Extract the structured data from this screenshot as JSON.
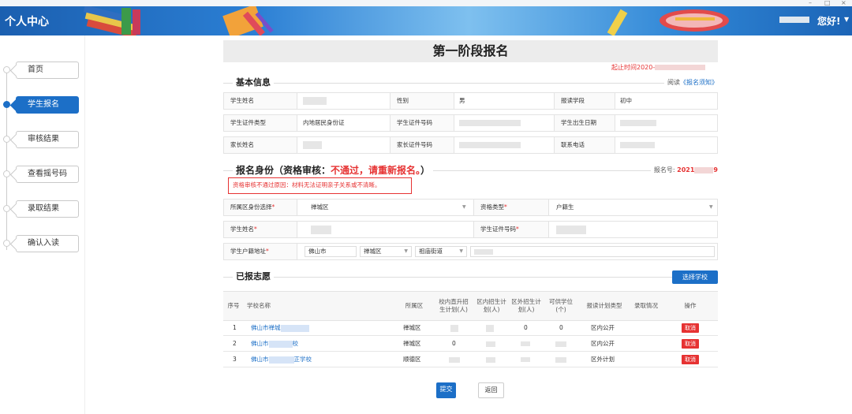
{
  "window": {
    "minimize": "–",
    "maximize": "□",
    "close": "×"
  },
  "header": {
    "title": "个人中心",
    "greeting": "您好!",
    "caret": "▼"
  },
  "sidebar": {
    "items": [
      {
        "label": "首页",
        "active": false
      },
      {
        "label": "学生报名",
        "active": true
      },
      {
        "label": "审核结果",
        "active": false
      },
      {
        "label": "查看摇号码",
        "active": false
      },
      {
        "label": "录取结果",
        "active": false
      },
      {
        "label": "确认入读",
        "active": false
      }
    ]
  },
  "page": {
    "title": "第一阶段报名",
    "deadline_prefix": "起止时间2020-",
    "basic": {
      "title": "基本信息",
      "read_prefix": "阅读",
      "notice_link": "《报名须知》",
      "rows": [
        [
          "学生姓名",
          "",
          "性别",
          "男",
          "报读学段",
          "初中"
        ],
        [
          "学生证件类型",
          "内地居民身份证",
          "学生证件号码",
          "",
          "学生出生日期",
          ""
        ],
        [
          "家长姓名",
          "",
          "家长证件号码",
          "",
          "联系电话",
          ""
        ]
      ]
    },
    "status": {
      "heading_prefix": "报名身份（资格审核：",
      "heading_status": "不通过，请重新报名。",
      "heading_suffix": "）",
      "reg_label": "报名号:",
      "reg_prefix": "2021",
      "reg_suffix": "9",
      "reason": "资格审核不通过原因：材料无法证明亲子关系或不清晰。"
    },
    "form": {
      "district_label": "所属区身份选择",
      "district_value": "禅城区",
      "qual_label": "资格类型",
      "qual_value": "户籍生",
      "name_label": "学生姓名",
      "id_label": "学生证件号码",
      "addr_label": "学生户籍地址",
      "addr_city": "佛山市",
      "addr_district": "禅城区",
      "addr_street": "祖庙街道",
      "required_mark": "*"
    },
    "choices": {
      "title": "已报志愿",
      "select_button": "选择学校",
      "headers": [
        "序号",
        "学校名称",
        "所属区",
        "校内直升招生计划(人)",
        "区内招生计划(人)",
        "区外招生计划(人)",
        "可供学位(个)",
        "报读计划类型",
        "录取情况",
        "操作"
      ],
      "rows": [
        {
          "no": "1",
          "school_prefix": "佛山市禅城",
          "school_suffix": "",
          "district": "禅城区",
          "c1": "",
          "c2": "",
          "c3": "0",
          "c4": "0",
          "plan": "区内公开",
          "action": "取消"
        },
        {
          "no": "2",
          "school_prefix": "佛山市",
          "school_suffix": "校",
          "district": "禅城区",
          "c1": "0",
          "c2": "",
          "c3": "",
          "c4": "",
          "plan": "区内公开",
          "action": "取消"
        },
        {
          "no": "3",
          "school_prefix": "佛山市",
          "school_suffix": "正学校",
          "district": "顺德区",
          "c1": "",
          "c2": "",
          "c3": "",
          "c4": "",
          "plan": "区外计划",
          "action": "取消"
        }
      ]
    },
    "submit": "提交",
    "back": "返回"
  },
  "colors": {
    "primary": "#1c6fc7",
    "danger": "#e63232",
    "header": "#2b7fd4"
  }
}
